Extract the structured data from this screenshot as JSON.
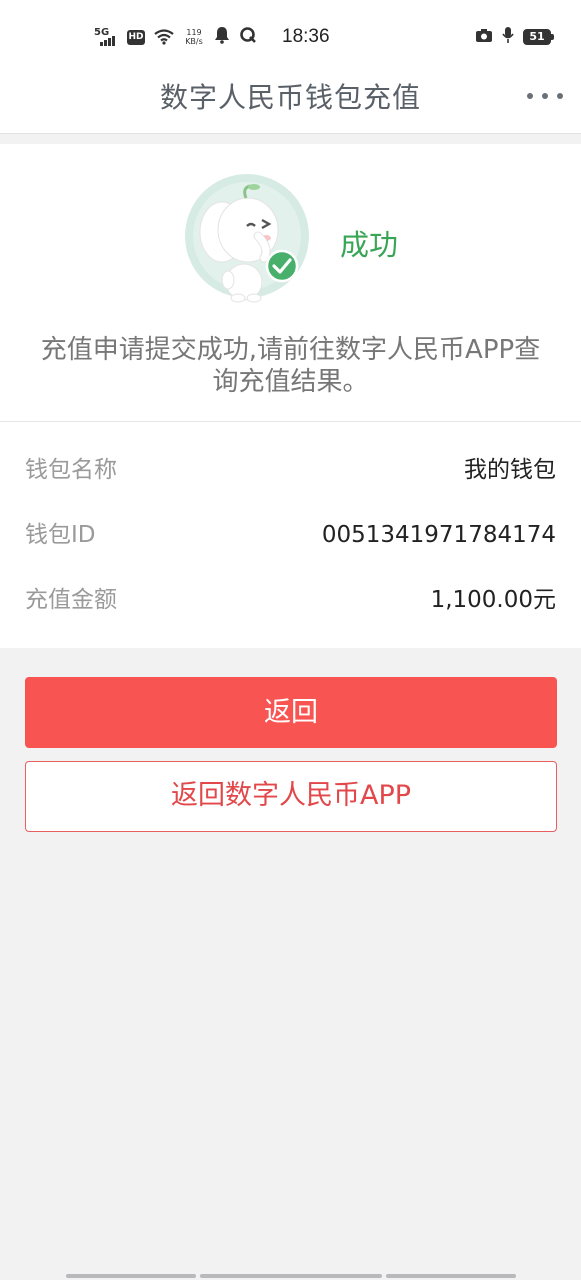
{
  "status_bar": {
    "network": "5G",
    "hd_badge": "HD",
    "speed_value": "119",
    "speed_unit": "KB/s",
    "time": "18:36",
    "battery": "51"
  },
  "header": {
    "title": "数字人民币钱包充值"
  },
  "result": {
    "status": "成功",
    "message": "充值申请提交成功,请前往数字人民币APP查询充值结果。",
    "colors": {
      "success": "#3aa557"
    }
  },
  "details": [
    {
      "label": "钱包名称",
      "value": "我的钱包"
    },
    {
      "label": "钱包ID",
      "value": "0051341971784174"
    },
    {
      "label": "充值金额",
      "value": "1,100.00元"
    }
  ],
  "actions": {
    "back_label": "返回",
    "app_label": "返回数字人民币APP",
    "colors": {
      "primary": "#f85452",
      "outline": "#e2474a"
    }
  },
  "icons": [
    "signal-icon",
    "hd-icon",
    "wifi-icon",
    "notification-bell-icon",
    "qq-browser-icon",
    "camera-icon",
    "microphone-icon",
    "battery-icon",
    "more-icon",
    "success-check-icon"
  ]
}
